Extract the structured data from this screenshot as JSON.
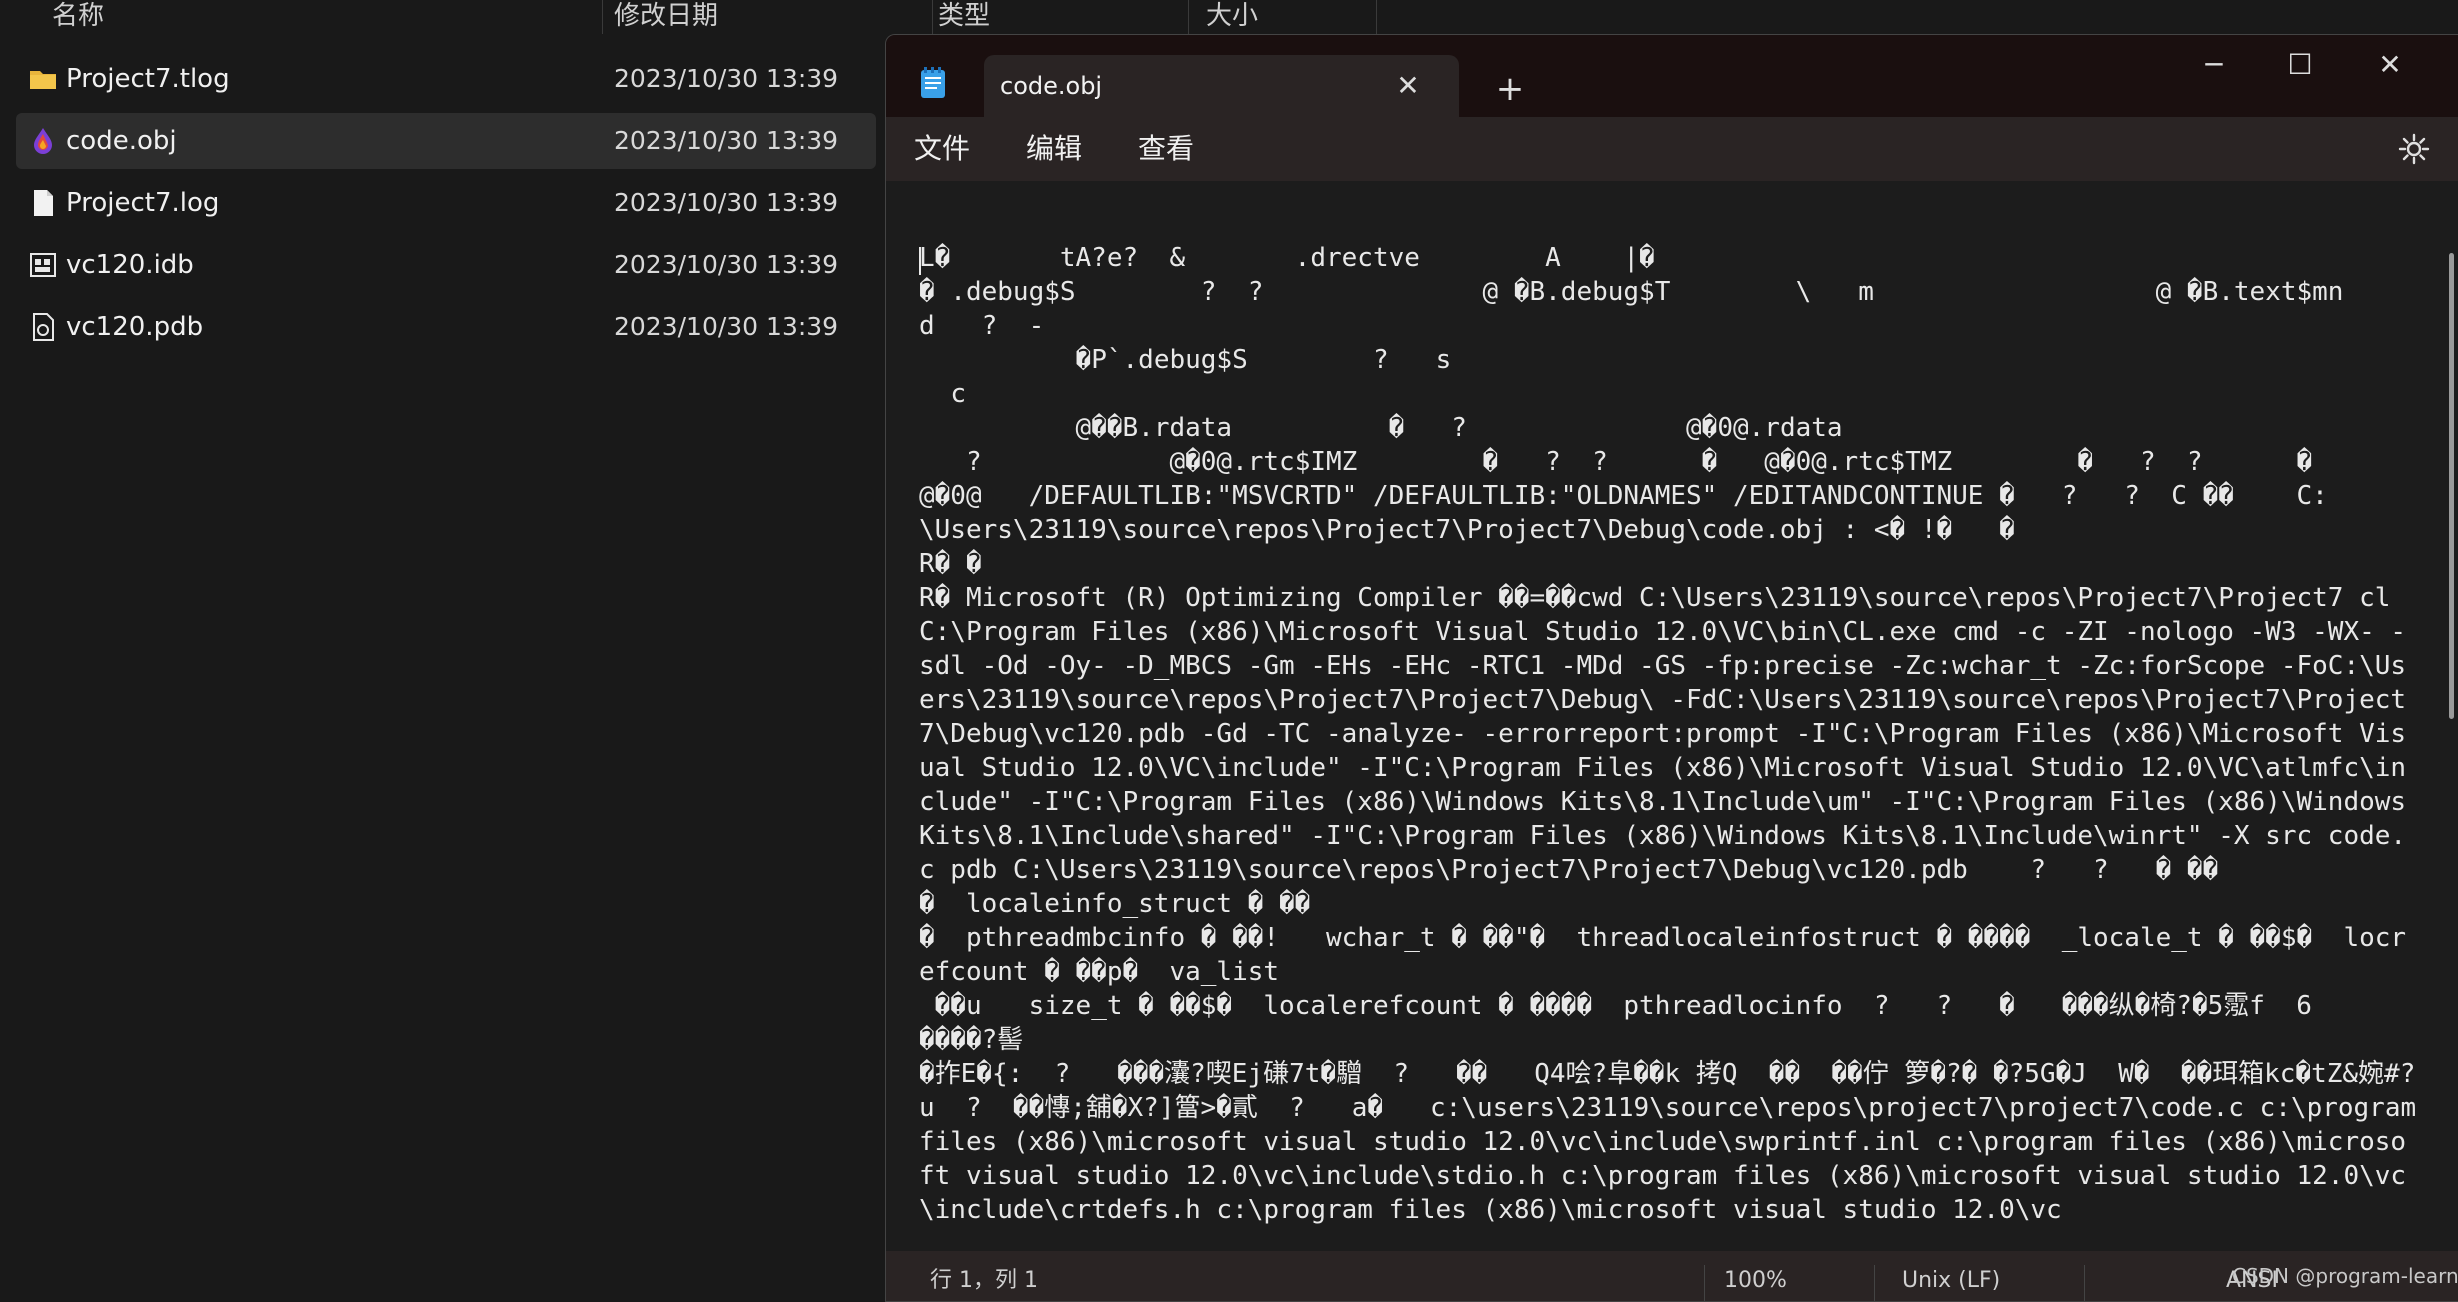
{
  "explorer": {
    "columns": [
      "名称",
      "修改日期",
      "类型",
      "大小"
    ],
    "files": [
      {
        "name": "Project7.tlog",
        "date": "2023/10/30 13:39",
        "icon": "folder-icon"
      },
      {
        "name": "code.obj",
        "date": "2023/10/30 13:39",
        "icon": "drop-icon"
      },
      {
        "name": "Project7.log",
        "date": "2023/10/30 13:39",
        "icon": "text-file-icon"
      },
      {
        "name": "vc120.idb",
        "date": "2023/10/30 13:39",
        "icon": "database-file-icon"
      },
      {
        "name": "vc120.pdb",
        "date": "2023/10/30 13:39",
        "icon": "pdb-file-icon"
      }
    ]
  },
  "notepad": {
    "tab_title": "code.obj",
    "menu": [
      "文件",
      "编辑",
      "查看"
    ],
    "content": "L�       tA?e?  &       .drectve        A    |�\n� .debug$S        ?  ?              @ �B.debug$T        \\   m                  @ �B.text$mn\nd   ?  -\n          �P`.debug$S        ?   s\n  c\n          @��B.rdata          �   ?              @�0@.rdata\n   ?            @�0@.rtc$IMZ        �   ?  ?      �   @�0@.rtc$TMZ        �   ?  ?      �\n@�0@   /DEFAULTLIB:\"MSVCRTD\" /DEFAULTLIB:\"OLDNAMES\" /EDITANDCONTINUE �   ?   ?  C ��    C:\n\\Users\\23119\\source\\repos\\Project7\\Project7\\Debug\\code.obj : <� !�   �\nR� �\nR� Microsoft (R) Optimizing Compiler ��=��cwd C:\\Users\\23119\\source\\repos\\Project7\\Project7 cl C:\\Program Files (x86)\\Microsoft Visual Studio 12.0\\VC\\bin\\CL.exe cmd -c -ZI -nologo -W3 -WX- -sdl -Od -Oy- -D_MBCS -Gm -EHs -EHc -RTC1 -MDd -GS -fp:precise -Zc:wchar_t -Zc:forScope -FoC:\\Users\\23119\\source\\repos\\Project7\\Project7\\Debug\\ -FdC:\\Users\\23119\\source\\repos\\Project7\\Project7\\Debug\\vc120.pdb -Gd -TC -analyze- -errorreport:prompt -I\"C:\\Program Files (x86)\\Microsoft Visual Studio 12.0\\VC\\include\" -I\"C:\\Program Files (x86)\\Microsoft Visual Studio 12.0\\VC\\atlmfc\\include\" -I\"C:\\Program Files (x86)\\Windows Kits\\8.1\\Include\\um\" -I\"C:\\Program Files (x86)\\Windows Kits\\8.1\\Include\\shared\" -I\"C:\\Program Files (x86)\\Windows Kits\\8.1\\Include\\winrt\" -X src code.c pdb C:\\Users\\23119\\source\\repos\\Project7\\Project7\\Debug\\vc120.pdb    ?   ?   � ��\n�  localeinfo_struct � ��\n�  pthreadmbcinfo � ��!   wchar_t � ��\"�  threadlocaleinfostruct � ����  _locale_t � ��$�  locrefcount � ��p�  va_list\n ��u   size_t � ��$�  localerefcount � ����  pthreadlocinfo  ?   ?   �   ���纵�椅?�5霐f  6\n����?髻\n�拃E�{:  ?   ���灢?喫Ej磏7t�驓  ?   ��   Q4哙?阜��k 拷Q  ��  ��佇 箩�?� �?5G�J  W�  ��珥箱kc�tZ&婉#?u  ?  ��慱;舖�X?]簹>�貳  ?   a�   c:\\users\\23119\\source\\repos\\project7\\project7\\code.c c:\\program files (x86)\\microsoft visual studio 12.0\\vc\\include\\swprintf.inl c:\\program files (x86)\\microsoft visual studio 12.0\\vc\\include\\stdio.h c:\\program files (x86)\\microsoft visual studio 12.0\\vc\\include\\crtdefs.h c:\\program files (x86)\\microsoft visual studio 12.0\\vc",
    "status": {
      "position": "行 1，列 1",
      "zoom": "100%",
      "line_ending": "Unix (LF)",
      "encoding": "ANSI"
    }
  },
  "watermark": "CSDN @program-learner",
  "colors": {
    "titlebar": "#1a0f0f",
    "menubar": "#2a2424",
    "explorer_bg": "#191919",
    "editor_bg": "#1c1c1c"
  }
}
